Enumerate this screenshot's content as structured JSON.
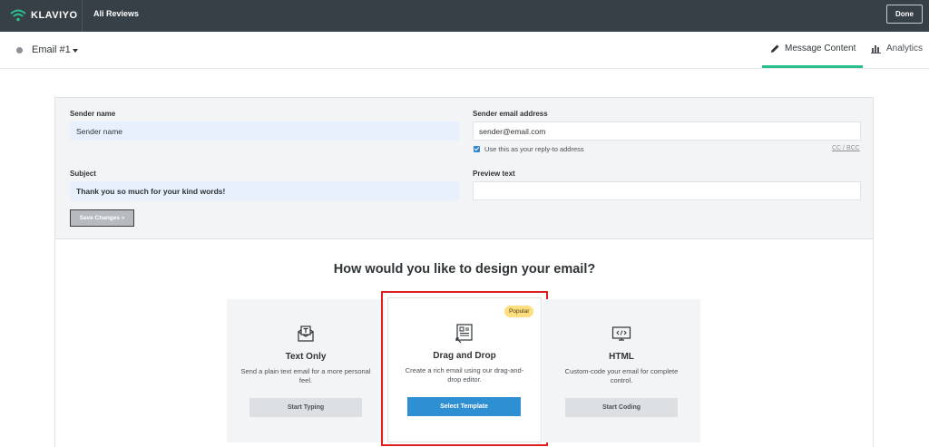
{
  "topbar": {
    "logo_text": "KLAVIYO",
    "app_name": "Ali Reviews",
    "done_label": "Done"
  },
  "subheader": {
    "email_name": "Email #1",
    "tabs": [
      {
        "label": "Message Content",
        "icon": "pencil-icon",
        "active": true
      },
      {
        "label": "Analytics",
        "icon": "bar-chart-icon",
        "active": false
      }
    ],
    "active_tab_color": "#29c08c"
  },
  "form": {
    "sender_name": {
      "label": "Sender name",
      "value": "Sender name"
    },
    "sender_email": {
      "label": "Sender email address",
      "value": "sender@email.com"
    },
    "reply_to": {
      "label": "Use this as your reply-to address",
      "checked": true
    },
    "cc_bcc": "CC / BCC",
    "subject": {
      "label": "Subject",
      "value": "Thank you so much for your kind words!"
    },
    "preview_text": {
      "label": "Preview text",
      "value": ""
    },
    "save_label": "Save Changes »"
  },
  "design": {
    "title": "How would you like to design your email?",
    "options": [
      {
        "title": "Text Only",
        "description": "Send a plain text email for a more personal feel.",
        "button": "Start Typing",
        "icon": "text-envelope-icon"
      },
      {
        "title": "Drag and Drop",
        "description": "Create a rich email using our drag-and-drop editor.",
        "button": "Select Template",
        "badge": "Popular",
        "icon": "drag-drop-layout-icon"
      },
      {
        "title": "HTML",
        "description": "Custom-code your email for complete control.",
        "button": "Start Coding",
        "icon": "code-monitor-icon"
      }
    ],
    "accent_color": "#2f8fd3",
    "highlight_color": "#e02020"
  }
}
